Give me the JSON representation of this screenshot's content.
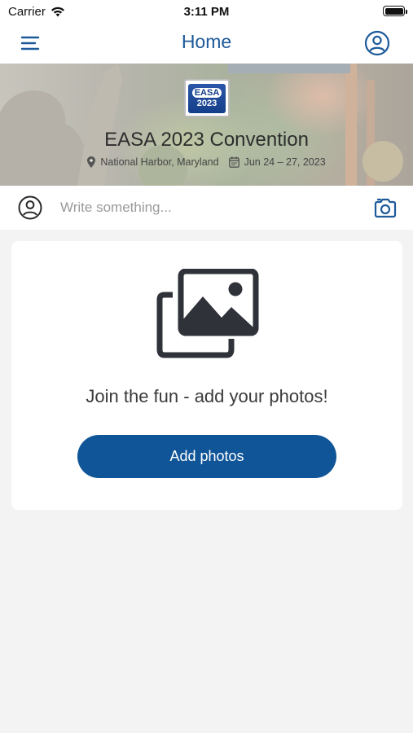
{
  "status_bar": {
    "carrier": "Carrier",
    "time": "3:11 PM",
    "icons": [
      "wifi-icon",
      "battery-icon"
    ]
  },
  "nav": {
    "title": "Home",
    "left_icon": "menu-icon",
    "right_icon": "profile-icon",
    "accent_color": "#1d5a9a"
  },
  "hero": {
    "logo": {
      "name": "EASA",
      "year": "2023"
    },
    "title": "EASA 2023 Convention",
    "location": "National Harbor, Maryland",
    "dates": "Jun 24 – 27, 2023"
  },
  "composer": {
    "placeholder": "Write something...",
    "icons": [
      "avatar-icon",
      "camera-icon"
    ]
  },
  "photos_card": {
    "icon": "gallery-icon",
    "message": "Join the fun - add your photos!",
    "button_label": "Add photos",
    "button_color": "#0f5597"
  }
}
